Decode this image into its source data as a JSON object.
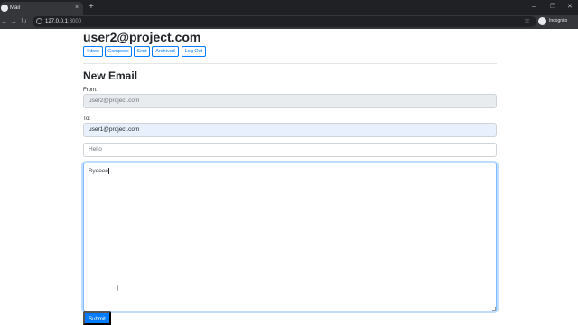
{
  "browser": {
    "tab_title": "Mail",
    "tab_close": "×",
    "new_tab": "+",
    "url_host": "127.0.0.1",
    "url_port": ":8000",
    "profile_label": "Incognito",
    "icons": [
      "favicon-icon",
      "close-icon",
      "plus-icon",
      "back-icon",
      "forward-icon",
      "reload-icon",
      "info-icon",
      "star-icon",
      "incognito-icon"
    ]
  },
  "page": {
    "user_email": "user2@project.com",
    "nav": [
      {
        "label": "Inbox"
      },
      {
        "label": "Compose"
      },
      {
        "label": "Sent"
      },
      {
        "label": "Archived"
      },
      {
        "label": "Log Out"
      }
    ],
    "compose": {
      "title": "New Email",
      "from_label": "From:",
      "from_value": "user2@project.com",
      "to_label": "To:",
      "to_value": "user1@project.com",
      "subject_value": "Hello",
      "body_value": "Byeeee",
      "submit_label": "Submit"
    }
  },
  "colors": {
    "accent": "#007bff",
    "chrome_dark": "#202124",
    "chrome_mid": "#35363a"
  }
}
